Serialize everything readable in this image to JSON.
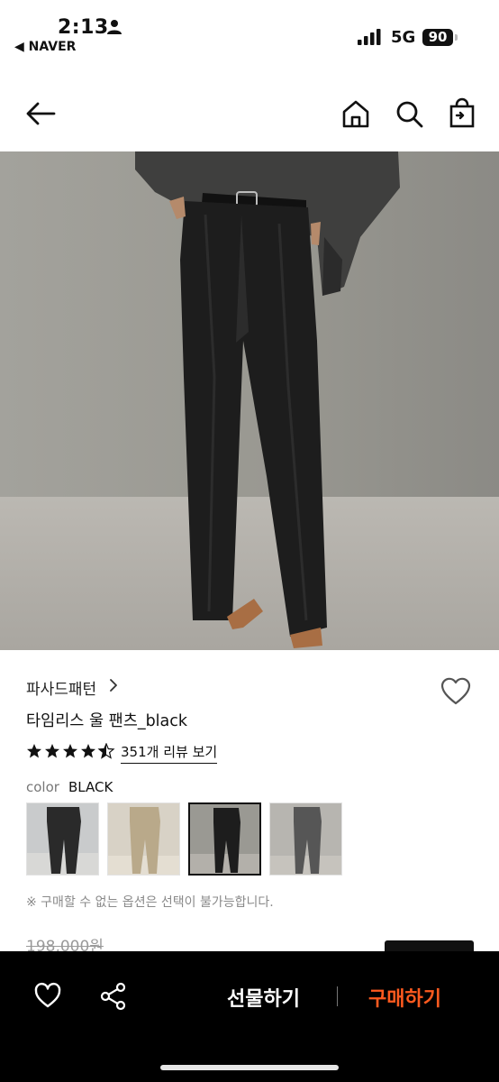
{
  "status_bar": {
    "time": "2:13",
    "back_app": "◀ NAVER",
    "network": "5G",
    "battery": "90"
  },
  "nav": {
    "icons": [
      "back-arrow-icon",
      "home-icon",
      "search-icon",
      "shopping-bag-icon"
    ]
  },
  "product": {
    "brand": "파사드패턴",
    "title": "타임리스 울 팬츠_black",
    "rating": 4.5,
    "reviews_link": "351개 리뷰 보기",
    "color_label": "color",
    "color_value": "BLACK",
    "swatch_count": 4,
    "selected_swatch": 3,
    "notice": "※ 구매할 수 없는 옵션은 선택이 불가능합니다.",
    "original_price": "198,000원"
  },
  "bottom_bar": {
    "gift_label": "선물하기",
    "buy_label": "구매하기"
  },
  "colors": {
    "buy_accent": "#ff5a1f",
    "bottom_bar_bg": "#000000"
  }
}
